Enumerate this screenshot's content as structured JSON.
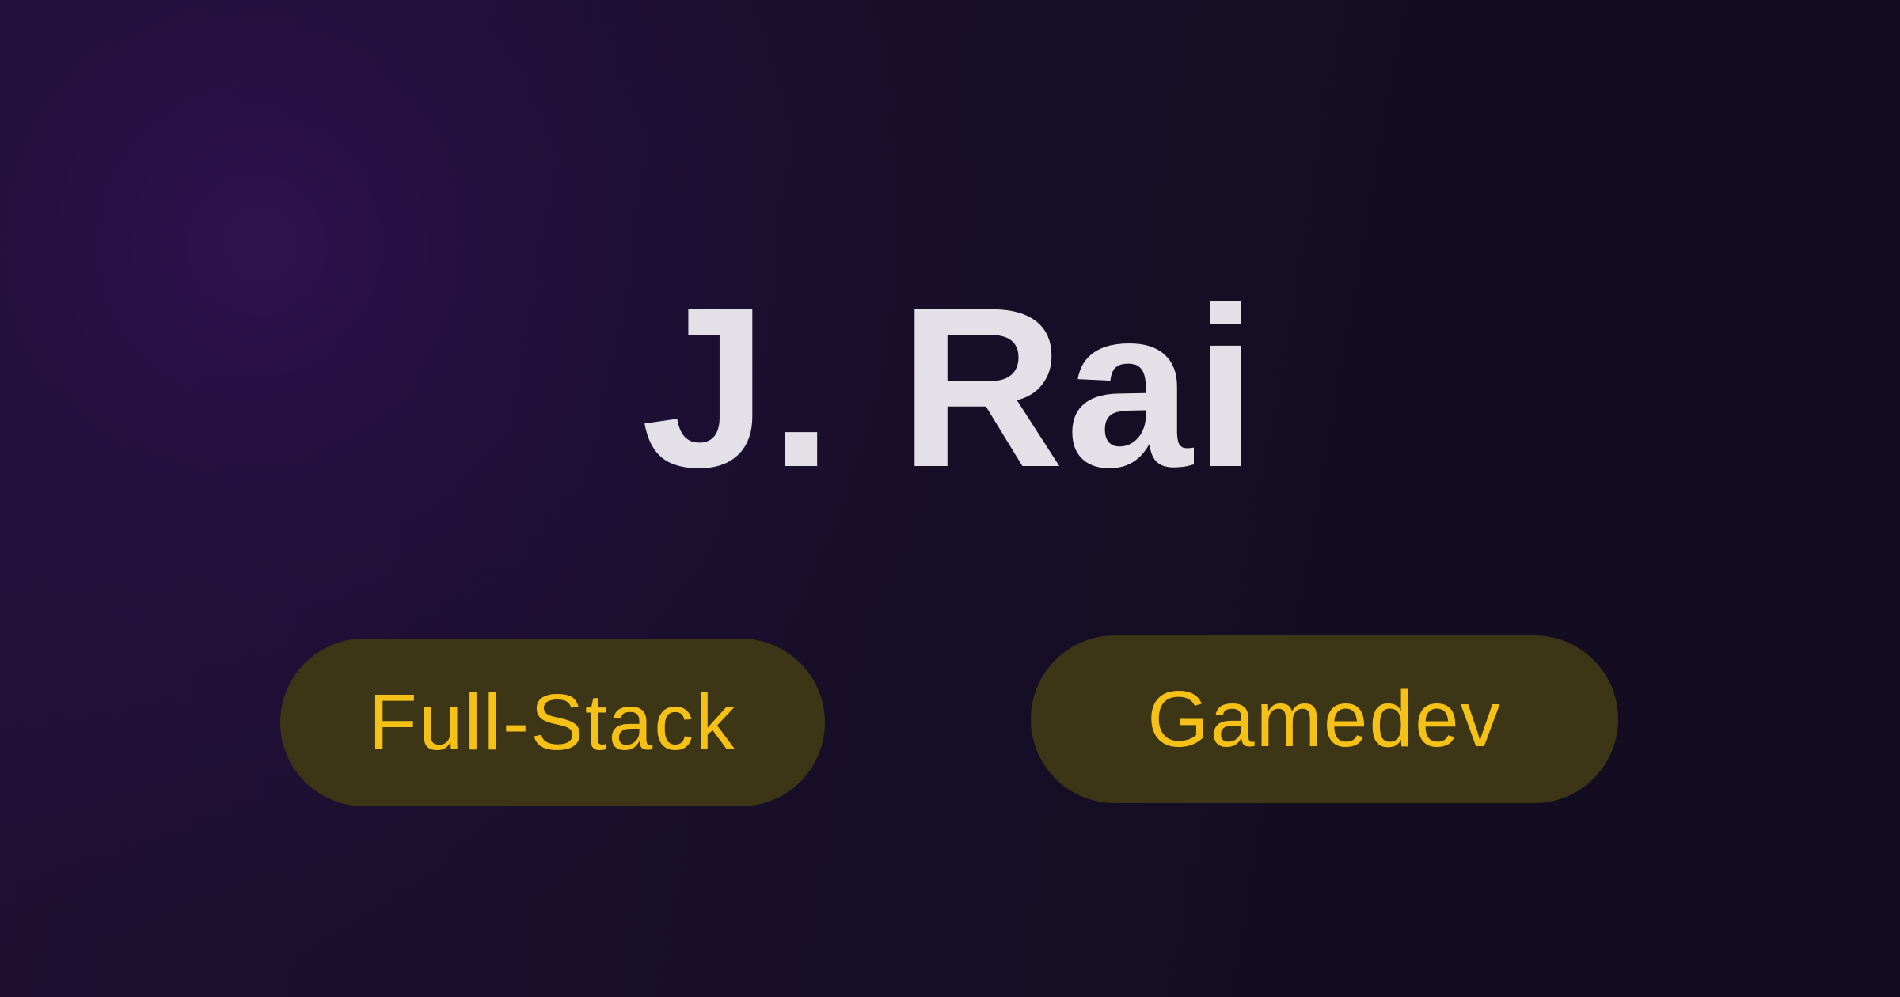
{
  "name": "J. Rai",
  "tags": [
    {
      "label": "Full-Stack"
    },
    {
      "label": "Gamedev"
    }
  ],
  "colors": {
    "background": "#150d22",
    "background_glow": "#341258",
    "title_text": "#e4e0e8",
    "pill_background": "#3c3616",
    "pill_text": "#f5c116"
  }
}
